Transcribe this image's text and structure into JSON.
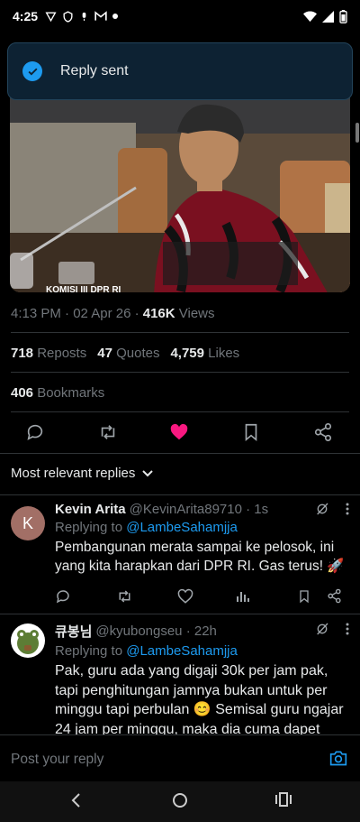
{
  "status_bar": {
    "time": "4:25"
  },
  "toast": {
    "message": "Reply sent"
  },
  "tweet": {
    "time": "4:13 PM · 02 Apr 26 · ",
    "views_count": "416K",
    "views_label": " Views",
    "reposts_count": "718",
    "reposts_label": " Reposts",
    "quotes_count": "47",
    "quotes_label": " Quotes",
    "likes_count": "4,759",
    "likes_label": " Likes",
    "bookmarks_count": "406",
    "bookmarks_label": " Bookmarks",
    "media_caption": "KOMISI III DPR RI"
  },
  "sort": {
    "label": "Most relevant replies"
  },
  "replies": [
    {
      "avatar_letter": "K",
      "name": "Kevin Arita",
      "handle": "@KevinArita89710 · 1s",
      "replying_prefix": "Replying to ",
      "replying_to": "@LambeSahamjja",
      "text": "Pembangunan merata sampai ke pelosok, ini yang kita harapkan dari DPR RI. Gas terus! 🚀"
    },
    {
      "name": "큐봉님",
      "handle": "@kyubongseu · 22h",
      "replying_prefix": "Replying to ",
      "replying_to": "@LambeSahamjja",
      "text": "Pak, guru ada yang digaji 30k per jam pak, tapi penghitungan jamnya bukan untuk per minggu tapi perbulan 😊 Semisal guru ngajar 24 jam per minggu, maka dia cuma dapet"
    }
  ],
  "composer": {
    "placeholder": "Post your reply"
  },
  "colors": {
    "accent": "#1d9bf0",
    "like": "#f91880",
    "muted": "#71767b",
    "background": "#000000"
  }
}
